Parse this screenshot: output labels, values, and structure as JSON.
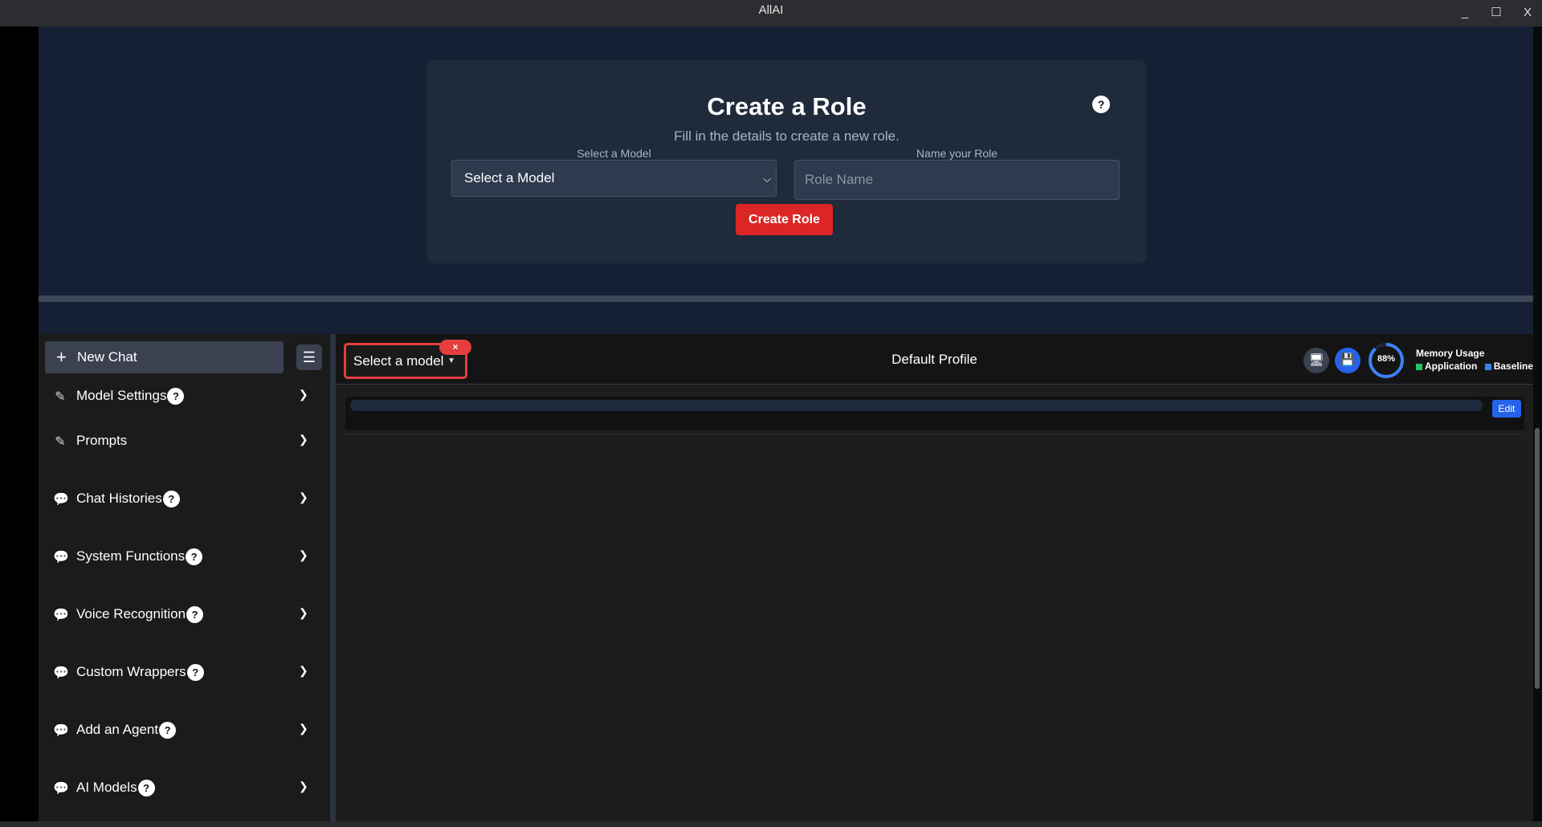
{
  "window": {
    "title": "AllAI",
    "minimize": "_",
    "maximize": "☐",
    "close": "X"
  },
  "role_form": {
    "title": "Create a Role",
    "help": "?",
    "subtitle": "Fill in the details to create a new role.",
    "model_label": "Select a Model",
    "model_value": "Select a Model",
    "role_label": "Name your Role",
    "role_placeholder": "Role Name",
    "create_button": "Create Role"
  },
  "sidebar": {
    "new_chat": "New Chat",
    "items": [
      {
        "label": "Model Settings",
        "help": "?",
        "icon": "pencil-icon"
      },
      {
        "label": "Prompts",
        "help": "",
        "icon": "pencil-icon"
      },
      {
        "label": "Chat Histories",
        "help": "?",
        "icon": "chat-bubble-icon"
      },
      {
        "label": "System Functions",
        "help": "?",
        "icon": "chat-bubble-icon"
      },
      {
        "label": "Voice Recognition",
        "help": "?",
        "icon": "chat-bubble-icon"
      },
      {
        "label": "Custom Wrappers",
        "help": "?",
        "icon": "chat-bubble-icon"
      },
      {
        "label": "Add an Agent",
        "help": "?",
        "icon": "chat-bubble-icon"
      },
      {
        "label": "AI Models",
        "help": "?",
        "icon": "chat-bubble-icon"
      }
    ]
  },
  "chat": {
    "model_dropdown": "Select a model",
    "model_clear": "×",
    "profile": "Default Profile",
    "memory": {
      "percent": "88%",
      "percent_value": 0.88,
      "title": "Memory Usage",
      "legend_application": "Application",
      "legend_baseline": "Baseline"
    },
    "edit_button": "Edit"
  },
  "colors": {
    "accent_blue": "#2563eb",
    "danger_red": "#dc2626",
    "application_green": "#22c55e",
    "baseline_blue": "#3b82f6"
  }
}
